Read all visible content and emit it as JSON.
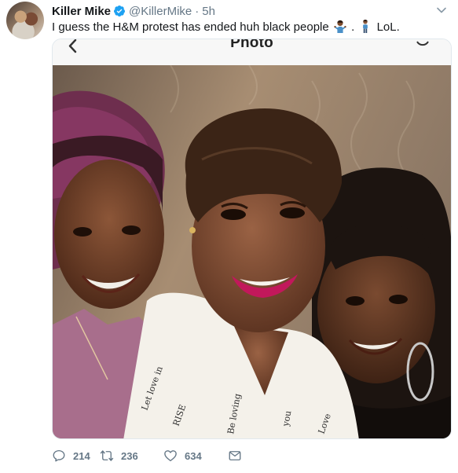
{
  "tweet": {
    "display_name": "Killer Mike",
    "handle": "@KillerMike",
    "separator": "·",
    "time": "5h",
    "text_main": "I guess the H&M protest has ended huh black people",
    "text_dot": ".",
    "text_end": "LoL.",
    "icons": {
      "verified": "verified-badge-icon",
      "caret": "chevron-down-icon",
      "emoji_1": "man-shrugging-emoji",
      "emoji_2": "person-standing-emoji"
    }
  },
  "media": {
    "title": "Photo",
    "icons": {
      "back": "chevron-left-icon",
      "refresh": "refresh-icon"
    },
    "description": "selfie-photo"
  },
  "actions": {
    "reply_count": "214",
    "retweet_count": "236",
    "like_count": "634",
    "icons": {
      "reply": "reply-icon",
      "retweet": "retweet-icon",
      "like": "heart-icon",
      "dm": "envelope-icon"
    }
  },
  "colors": {
    "accent": "#1da1f2",
    "secondary_text": "#657786",
    "primary_text": "#14171a",
    "border": "#e1e8ed"
  }
}
